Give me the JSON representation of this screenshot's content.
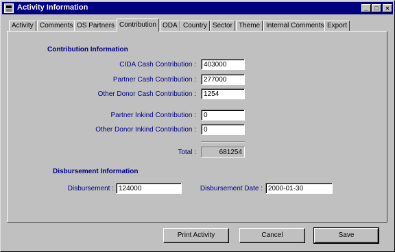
{
  "window": {
    "title": "Activity Information",
    "minimize": "_",
    "maximize": "□",
    "close": "×"
  },
  "tabs": [
    {
      "label": "Activity"
    },
    {
      "label": "Comments"
    },
    {
      "label": "OS Partners"
    },
    {
      "label": "Contribution"
    },
    {
      "label": "ODA"
    },
    {
      "label": "Country"
    },
    {
      "label": "Sector"
    },
    {
      "label": "Theme"
    },
    {
      "label": "Internal Comments"
    },
    {
      "label": "Export"
    }
  ],
  "active_tab": "Contribution",
  "contribution": {
    "title": "Contribution Information",
    "cida_cash": {
      "label": "CIDA Cash Contribution :",
      "value": "403000"
    },
    "partner_cash": {
      "label": "Partner Cash Contribution :",
      "value": "277000"
    },
    "other_donor_cash": {
      "label": "Other Donor Cash Contribution :",
      "value": "1254"
    },
    "partner_inkind": {
      "label": "Partner Inkind Contribution :",
      "value": "0"
    },
    "other_donor_inkind": {
      "label": "Other Donor Inkind Contribution :",
      "value": "0"
    },
    "total": {
      "label": "Total :",
      "value": "681254"
    }
  },
  "disbursement": {
    "title": "Disbursement Information",
    "amount": {
      "label": "Disbursement :",
      "value": "124000"
    },
    "date": {
      "label": "Disbursement Date :",
      "value": "2000-01-30"
    }
  },
  "buttons": {
    "print": "Print Activity",
    "cancel": "Cancel",
    "save": "Save"
  }
}
